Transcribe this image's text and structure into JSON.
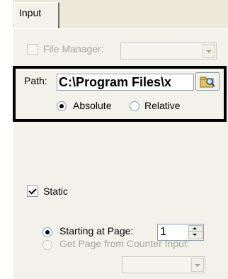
{
  "tabs": [
    {
      "label": "Input"
    }
  ],
  "file_manager": {
    "label": "File Manager:",
    "checked": false,
    "enabled": false,
    "value": ""
  },
  "path": {
    "label": "Path:",
    "value": "C:\\Program Files\\x",
    "browse_icon": "browse-folder-icon"
  },
  "path_mode": {
    "options": [
      {
        "label": "Absolute",
        "selected": true
      },
      {
        "label": "Relative",
        "selected": false
      }
    ]
  },
  "static": {
    "label": "Static",
    "checked": true
  },
  "starting_at_page": {
    "label": "Starting at Page:",
    "selected": true,
    "value": "1"
  },
  "counter_input": {
    "label": "Get Page from Counter Input:",
    "selected": false,
    "enabled": false,
    "value": ""
  }
}
